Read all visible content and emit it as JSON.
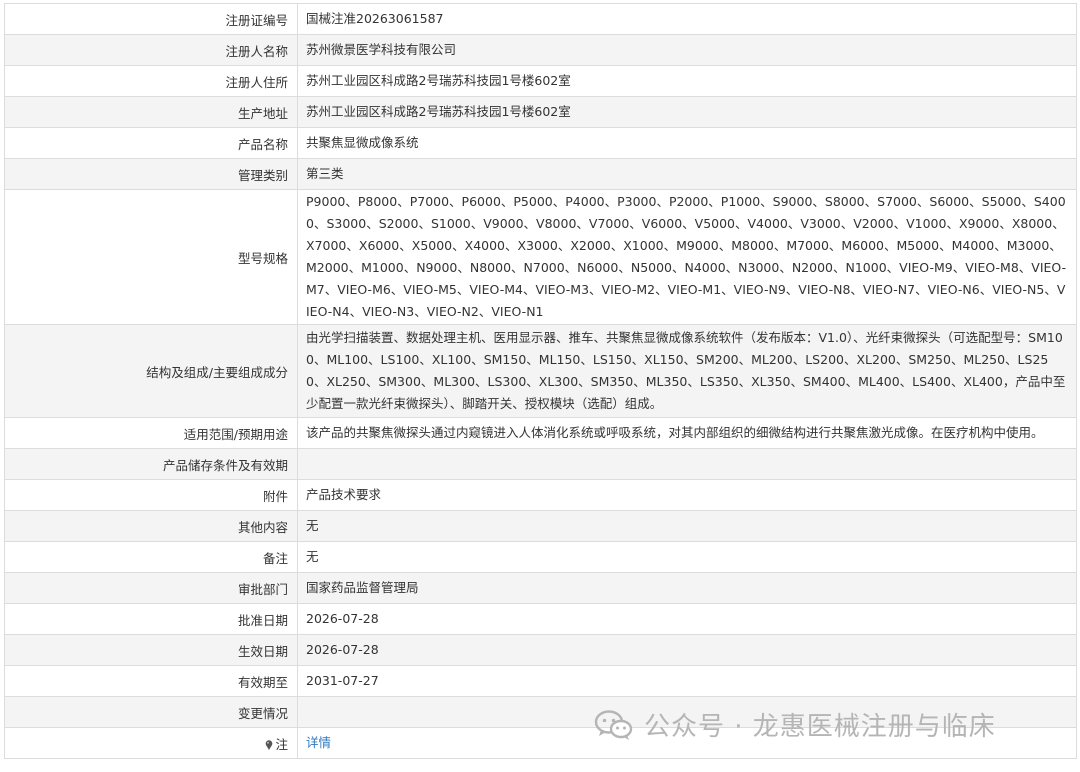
{
  "rows": [
    {
      "label": "注册证编号",
      "value": "国械注准20263061587"
    },
    {
      "label": "注册人名称",
      "value": "苏州微景医学科技有限公司"
    },
    {
      "label": "注册人住所",
      "value": "苏州工业园区科成路2号瑞苏科技园1号楼602室"
    },
    {
      "label": "生产地址",
      "value": "苏州工业园区科成路2号瑞苏科技园1号楼602室"
    },
    {
      "label": "产品名称",
      "value": "共聚焦显微成像系统"
    },
    {
      "label": "管理类别",
      "value": "第三类"
    },
    {
      "label": "型号规格",
      "value": "P9000、P8000、P7000、P6000、P5000、P4000、P3000、P2000、P1000、S9000、S8000、S7000、S6000、S5000、S4000、S3000、S2000、S1000、V9000、V8000、V7000、V6000、V5000、V4000、V3000、V2000、V1000、X9000、X8000、X7000、X6000、X5000、X4000、X3000、X2000、X1000、M9000、M8000、M7000、M6000、M5000、M4000、M3000、M2000、M1000、N9000、N8000、N7000、N6000、N5000、N4000、N3000、N2000、N1000、VIEO-M9、VIEO-M8、VIEO-M7、VIEO-M6、VIEO-M5、VIEO-M4、VIEO-M3、VIEO-M2、VIEO-M1、VIEO-N9、VIEO-N8、VIEO-N7、VIEO-N6、VIEO-N5、VIEO-N4、VIEO-N3、VIEO-N2、VIEO-N1"
    },
    {
      "label": "结构及组成/主要组成成分",
      "value": "由光学扫描装置、数据处理主机、医用显示器、推车、共聚焦显微成像系统软件（发布版本：V1.0）、光纤束微探头（可选配型号：SM100、ML100、LS100、XL100、SM150、ML150、LS150、XL150、SM200、ML200、LS200、XL200、SM250、ML250、LS250、XL250、SM300、ML300、LS300、XL300、SM350、ML350、LS350、XL350、SM400、ML400、LS400、XL400，产品中至少配置一款光纤束微探头）、脚踏开关、授权模块（选配）组成。"
    },
    {
      "label": "适用范围/预期用途",
      "value": "该产品的共聚焦微探头通过内窥镜进入人体消化系统或呼吸系统，对其内部组织的细微结构进行共聚焦激光成像。在医疗机构中使用。"
    },
    {
      "label": "产品储存条件及有效期",
      "value": ""
    },
    {
      "label": "附件",
      "value": "产品技术要求"
    },
    {
      "label": "其他内容",
      "value": "无"
    },
    {
      "label": "备注",
      "value": "无"
    },
    {
      "label": "审批部门",
      "value": "国家药品监督管理局"
    },
    {
      "label": "批准日期",
      "value": "2026-07-28"
    },
    {
      "label": "生效日期",
      "value": "2026-07-28"
    },
    {
      "label": "有效期至",
      "value": "2031-07-27"
    },
    {
      "label": "变更情况",
      "value": ""
    }
  ],
  "note": {
    "label": "注",
    "link_text": "详情"
  },
  "watermark": {
    "text": "公众号 · 龙惠医械注册与临床",
    "icon": "wechat-icon"
  },
  "colors": {
    "link": "#2d78c4",
    "border": "#dcdcdc",
    "stripe": "#f4f4f4",
    "watermark": "#b5b5b5"
  }
}
